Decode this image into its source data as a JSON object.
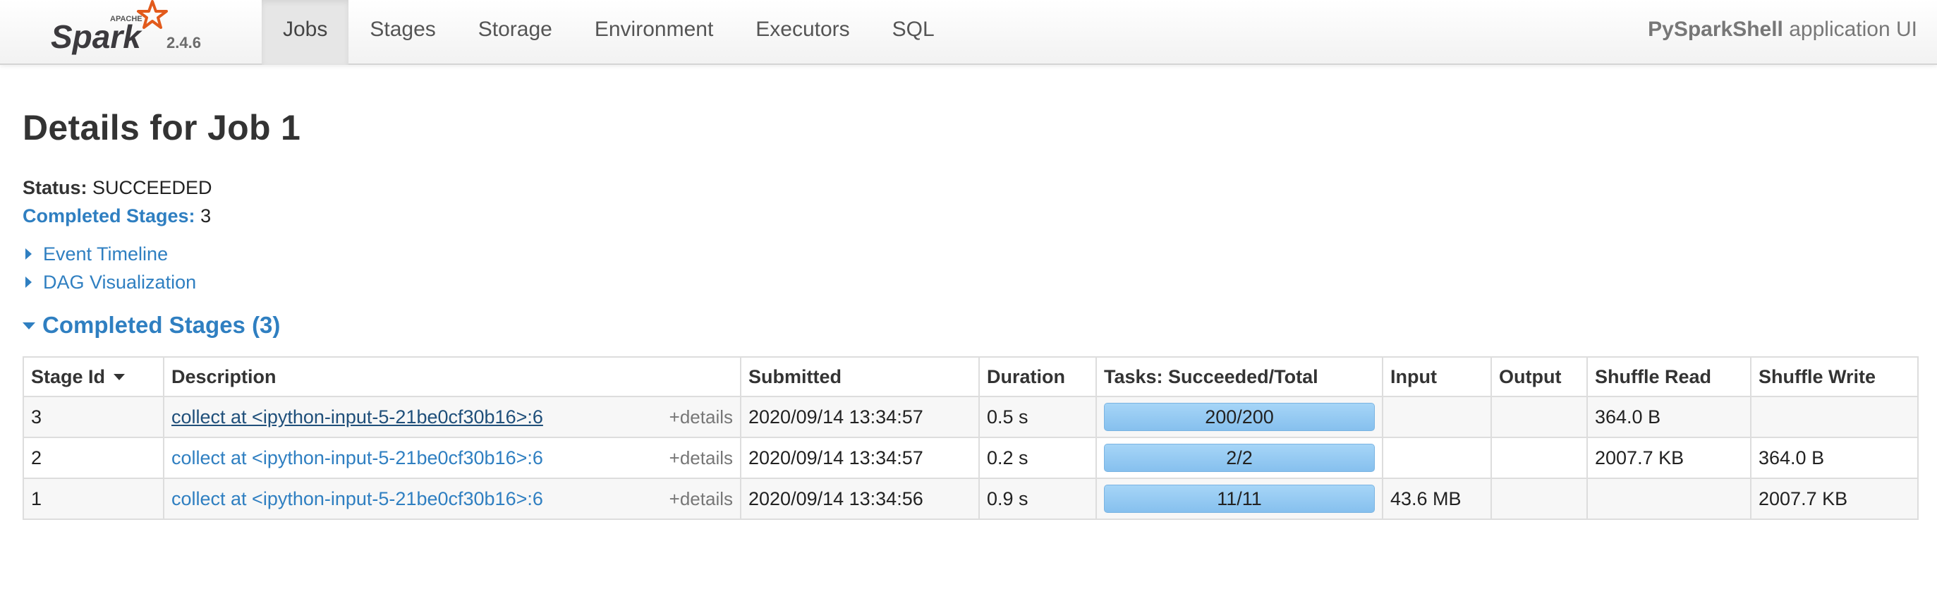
{
  "navbar": {
    "brand_small": "APACHE",
    "brand_name": "Spark",
    "version": "2.4.6",
    "tabs": [
      {
        "label": "Jobs",
        "active": true
      },
      {
        "label": "Stages",
        "active": false
      },
      {
        "label": "Storage",
        "active": false
      },
      {
        "label": "Environment",
        "active": false
      },
      {
        "label": "Executors",
        "active": false
      },
      {
        "label": "SQL",
        "active": false
      }
    ],
    "app_name": "PySparkShell",
    "app_suffix": " application UI"
  },
  "page": {
    "title": "Details for Job 1",
    "status_label": "Status:",
    "status_value": "SUCCEEDED",
    "completed_label": "Completed Stages:",
    "completed_value": "3",
    "event_timeline": "Event Timeline",
    "dag_visualization": "DAG Visualization",
    "section_title": "Completed Stages (3)"
  },
  "table": {
    "headers": {
      "stage_id": "Stage Id",
      "description": "Description",
      "submitted": "Submitted",
      "duration": "Duration",
      "tasks": "Tasks: Succeeded/Total",
      "input": "Input",
      "output": "Output",
      "shuffle_read": "Shuffle Read",
      "shuffle_write": "Shuffle Write"
    },
    "rows": [
      {
        "stage_id": "3",
        "description": "collect at <ipython-input-5-21be0cf30b16>:6",
        "details": "+details",
        "submitted": "2020/09/14 13:34:57",
        "duration": "0.5 s",
        "tasks": "200/200",
        "tasks_fraction": 1.0,
        "input": "",
        "output": "",
        "shuffle_read": "364.0 B",
        "shuffle_write": ""
      },
      {
        "stage_id": "2",
        "description": "collect at <ipython-input-5-21be0cf30b16>:6",
        "details": "+details",
        "submitted": "2020/09/14 13:34:57",
        "duration": "0.2 s",
        "tasks": "2/2",
        "tasks_fraction": 1.0,
        "input": "",
        "output": "",
        "shuffle_read": "2007.7 KB",
        "shuffle_write": "364.0 B"
      },
      {
        "stage_id": "1",
        "description": "collect at <ipython-input-5-21be0cf30b16>:6",
        "details": "+details",
        "submitted": "2020/09/14 13:34:56",
        "duration": "0.9 s",
        "tasks": "11/11",
        "tasks_fraction": 1.0,
        "input": "43.6 MB",
        "output": "",
        "shuffle_read": "",
        "shuffle_write": "2007.7 KB"
      }
    ]
  },
  "colors": {
    "link": "#2f7fc1",
    "logo_orange": "#e25a1c",
    "progress": "#8dc4ef"
  }
}
